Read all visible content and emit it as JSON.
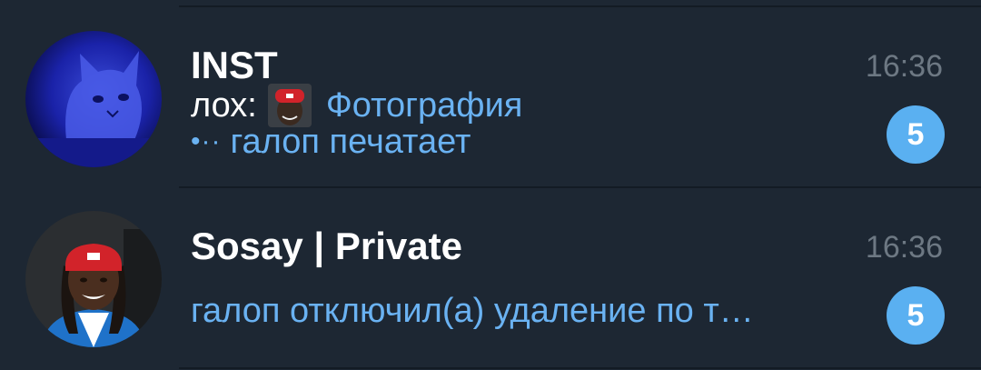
{
  "chats": [
    {
      "title": "INST",
      "time": "16:36",
      "message_sender": "лох:",
      "message_text": "Фотография",
      "typing_dots": "•··",
      "typing_text": "галоп печатает",
      "unread_count": "5",
      "avatar_icon": "cat-avatar-icon",
      "thumbnail_icon": "photo-thumbnail-icon"
    },
    {
      "title": "Sosay | Private",
      "time": "16:36",
      "message_text": "галоп отключил(а) удаление по т…",
      "unread_count": "5",
      "avatar_icon": "person-avatar-icon"
    }
  ],
  "colors": {
    "background": "#1d2733",
    "divider": "#131b24",
    "title": "#ffffff",
    "time": "#6d7883",
    "accent_blue": "#6ab2f2",
    "badge": "#5ab0f1"
  }
}
